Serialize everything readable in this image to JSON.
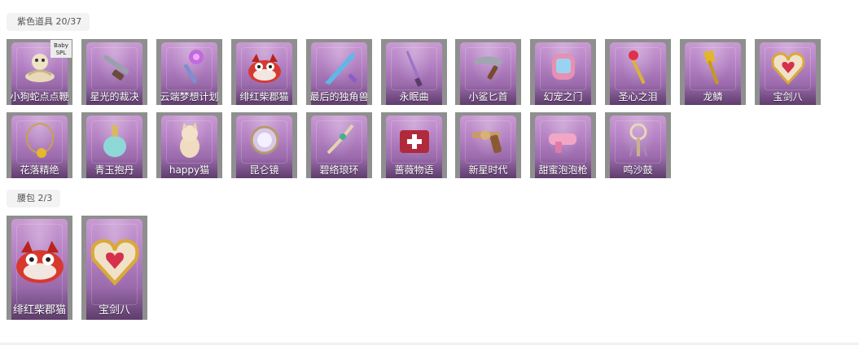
{
  "sections": [
    {
      "title": "紫色道具 20/37",
      "items": [
        {
          "name": "小狗蛇点点鞭",
          "icon": "snake-whip-icon"
        },
        {
          "name": "星光的裁决",
          "icon": "shotgun-icon"
        },
        {
          "name": "云端梦想计划",
          "icon": "mace-icon"
        },
        {
          "name": "绯红柴郡猫",
          "icon": "red-cat-icon"
        },
        {
          "name": "最后的独角兽",
          "icon": "unicorn-horn-icon"
        },
        {
          "name": "永眠曲",
          "icon": "dagger-icon"
        },
        {
          "name": "小鲨匕首",
          "icon": "shark-dagger-icon"
        },
        {
          "name": "幻宠之门",
          "icon": "pet-gate-icon"
        },
        {
          "name": "圣心之泪",
          "icon": "scepter-icon"
        },
        {
          "name": "龙鳞",
          "icon": "golden-shovel-icon"
        },
        {
          "name": "宝剑八",
          "icon": "heart-shield-icon"
        },
        {
          "name": "花落精绝",
          "icon": "flower-necklace-icon"
        },
        {
          "name": "青玉抱丹",
          "icon": "jade-bottle-icon"
        },
        {
          "name": "happy猫",
          "icon": "cat-plush-icon"
        },
        {
          "name": "昆仑镜",
          "icon": "mirror-icon"
        },
        {
          "name": "碧络琅环",
          "icon": "jade-ring-icon"
        },
        {
          "name": "蔷薇物语",
          "icon": "medkit-icon"
        },
        {
          "name": "新星时代",
          "icon": "revolver-icon"
        },
        {
          "name": "甜蜜泡泡枪",
          "icon": "bubble-gun-icon"
        },
        {
          "name": "鸣沙鼓",
          "icon": "drum-icon"
        }
      ]
    },
    {
      "title": "腰包 2/3",
      "items": [
        {
          "name": "绯红柴郡猫",
          "icon": "red-cat-icon"
        },
        {
          "name": "宝剑八",
          "icon": "heart-shield-icon"
        }
      ]
    }
  ],
  "corner_stamp": "Baby SPL"
}
